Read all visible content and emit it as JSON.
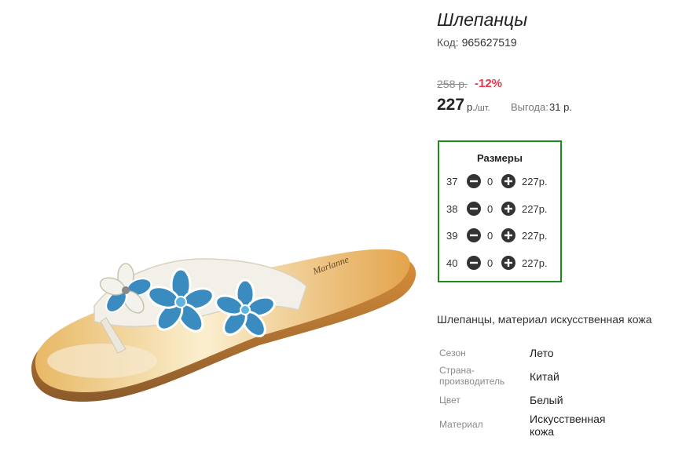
{
  "product": {
    "title": "Шлепанцы",
    "code_label": "Код:",
    "code_value": "965627519",
    "old_price": "258 р.",
    "discount": "-12%",
    "price": "227",
    "price_unit": "р.",
    "price_unit_suffix": "/шт.",
    "benefit_label": "Выгода:",
    "benefit_value": "31 р.",
    "description": "Шлепанцы, материал искусственная кожа",
    "brand_on_insole": "Marlanne"
  },
  "sizes": {
    "title": "Размеры",
    "rows": [
      {
        "size": "37",
        "qty": "0",
        "price": "227р."
      },
      {
        "size": "38",
        "qty": "0",
        "price": "227р."
      },
      {
        "size": "39",
        "qty": "0",
        "price": "227р."
      },
      {
        "size": "40",
        "qty": "0",
        "price": "227р."
      }
    ]
  },
  "properties": [
    {
      "label": "Сезон",
      "value": "Лето"
    },
    {
      "label": "Страна-\nпроизводитель",
      "value": "Китай"
    },
    {
      "label": "Цвет",
      "value": "Белый"
    },
    {
      "label": "Материал",
      "value": "Искусственная\nкожа"
    }
  ],
  "colors": {
    "accent_border": "#1e8a1e",
    "discount": "#e4384b",
    "button": "#333333"
  },
  "icons": {
    "minus": "minus-circle-icon",
    "plus": "plus-circle-icon"
  }
}
